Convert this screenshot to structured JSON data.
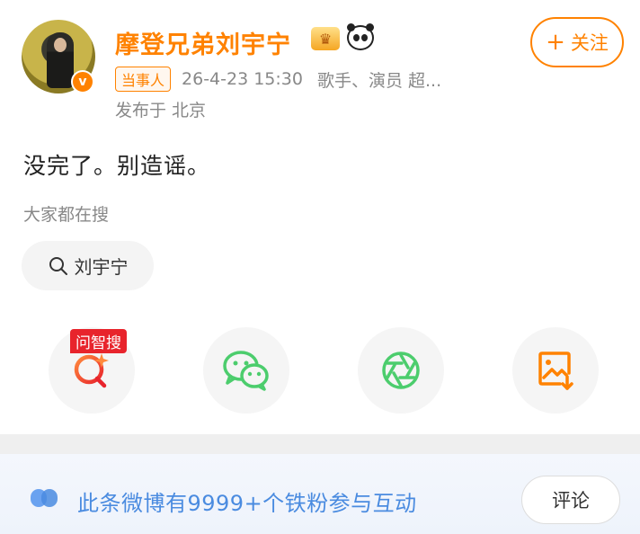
{
  "post": {
    "author_name": "摩登兄弟刘宇宁",
    "tag": "当事人",
    "time": "26-4-23 15:30",
    "bio": "歌手、演员 超...",
    "location": "发布于 北京",
    "content": "没完了。别造谣。",
    "follow_label": "关注",
    "verified_mark": "v"
  },
  "hot": {
    "label": "大家都在搜",
    "chip": "刘宇宁"
  },
  "share": {
    "ribbon": "问智搜",
    "items": [
      "zhisou-icon",
      "wechat-icon",
      "moments-icon",
      "save-image-icon"
    ]
  },
  "footer": {
    "fans_text": "此条微博有9999+个铁粉参与互动",
    "comment_label": "评论"
  },
  "colors": {
    "brand_orange": "#ff8200",
    "link_blue": "#4a8be0",
    "ribbon_red": "#e8242c",
    "wechat_green": "#4ccd6d"
  }
}
